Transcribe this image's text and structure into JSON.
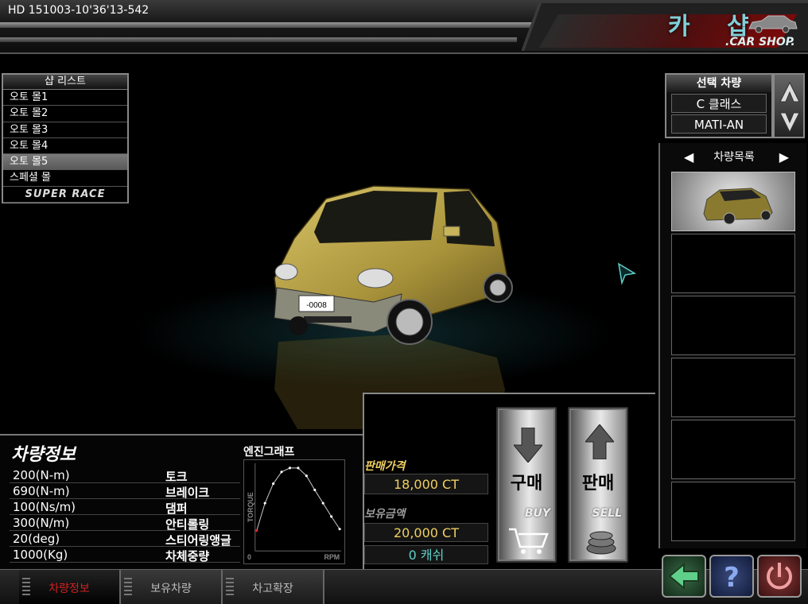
{
  "header": {
    "build_id": "HD 151003-10'36'13-542",
    "title_kr": "카 샵",
    "title_en": ".CAR SHOP."
  },
  "shop_list": {
    "header": "샵 리스트",
    "items": [
      {
        "label": "오토 몰1",
        "selected": false
      },
      {
        "label": "오토 몰2",
        "selected": false
      },
      {
        "label": "오토 몰3",
        "selected": false
      },
      {
        "label": "오토 몰4",
        "selected": false
      },
      {
        "label": "오토 몰5",
        "selected": true
      },
      {
        "label": "스페셜 몰",
        "selected": false
      },
      {
        "label": "SUPER RACE",
        "selected": false
      }
    ]
  },
  "selected_vehicle": {
    "header": "선택 차량",
    "class": "C 클래스",
    "model": "MATI-AN"
  },
  "car_list": {
    "title": "차량목록",
    "slots": 6
  },
  "car": {
    "plate": "-0008",
    "color": "#b8a040"
  },
  "vehicle_info": {
    "title": "차량정보",
    "specs": [
      {
        "value": "200(N-m)",
        "label": "토크"
      },
      {
        "value": "690(N-m)",
        "label": "브레이크"
      },
      {
        "value": "100(Ns/m)",
        "label": "댐퍼"
      },
      {
        "value": "300(N/m)",
        "label": "안티롤링"
      },
      {
        "value": "20(deg)",
        "label": "스티어링앵글"
      },
      {
        "value": "1000(Kg)",
        "label": "차체중량"
      }
    ]
  },
  "engine_graph": {
    "title": "엔진그래프",
    "y_label": "TORQUE",
    "x_label": "RPM",
    "origin_label": "0"
  },
  "chart_data": {
    "type": "line",
    "title": "엔진그래프",
    "xlabel": "RPM",
    "ylabel": "TORQUE",
    "x": [
      0,
      1,
      2,
      3,
      4,
      5,
      6,
      7,
      8,
      9,
      10
    ],
    "series": [
      {
        "values": [
          0.2,
          0.55,
          0.8,
          0.95,
          1.0,
          1.0,
          0.9,
          0.72,
          0.55,
          0.38,
          0.22
        ]
      }
    ],
    "grid": false
  },
  "trade": {
    "sale_price_label": "판매가격",
    "sale_price": "18,000 CT",
    "balance_label": "보유금액",
    "balance": "20,000 CT",
    "cash": "0 캐쉬",
    "buy_kr": "구매",
    "buy_en": "BUY",
    "sell_kr": "판매",
    "sell_en": "SELL"
  },
  "tabs": [
    {
      "label": "차량정보",
      "active": true
    },
    {
      "label": "보유차량",
      "active": false
    },
    {
      "label": "차고확장",
      "active": false
    }
  ],
  "colors": {
    "accent_gold": "#f0d060",
    "accent_teal": "#5fd0c8",
    "active_tab": "#d02020"
  }
}
